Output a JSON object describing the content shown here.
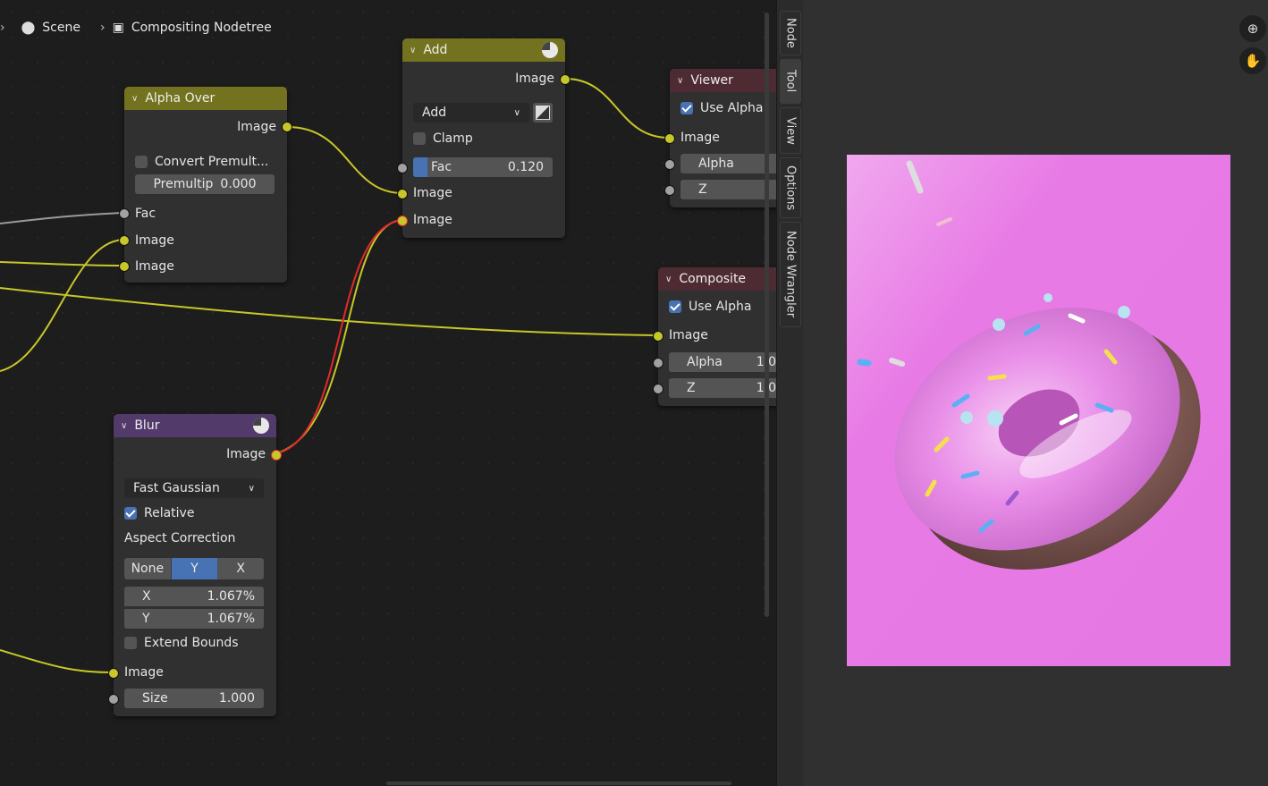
{
  "breadcrumb": {
    "scene": "Scene",
    "tree": "Compositing Nodetree"
  },
  "alpha_over": {
    "title": "Alpha Over",
    "out_image": "Image",
    "convert": "Convert Premult...",
    "premult_label": "Premultip",
    "premult_value": "0.000",
    "fac": "Fac",
    "image1": "Image",
    "image2": "Image"
  },
  "add": {
    "title": "Add",
    "out_image": "Image",
    "mode": "Add",
    "clamp": "Clamp",
    "fac_label": "Fac",
    "fac_value": "0.120",
    "image1": "Image",
    "image2": "Image"
  },
  "viewer": {
    "title": "Viewer",
    "use_alpha": "Use Alpha",
    "image": "Image",
    "alpha": "Alpha",
    "z": "Z"
  },
  "composite": {
    "title": "Composite",
    "use_alpha": "Use Alpha",
    "image": "Image",
    "alpha": "Alpha",
    "alpha_value": "1.0",
    "z": "Z",
    "z_value": "1.0"
  },
  "blur": {
    "title": "Blur",
    "out_image": "Image",
    "filter": "Fast Gaussian",
    "relative": "Relative",
    "aspect": "Aspect Correction",
    "opt_none": "None",
    "opt_y": "Y",
    "opt_x": "X",
    "x_label": "X",
    "x_value": "1.067%",
    "y_label": "Y",
    "y_value": "1.067%",
    "extend": "Extend Bounds",
    "in_image": "Image",
    "size_label": "Size",
    "size_value": "1.000"
  },
  "sidebar_tabs": [
    "Node",
    "Tool",
    "View",
    "Options",
    "Node Wrangler"
  ],
  "colors": {
    "converter_header": "#73731f",
    "filter_header": "#523a6b",
    "output_header": "#4e2b33",
    "socket_color": "#c7c729",
    "wire_yellow": "#c7c729",
    "wire_red": "#e02a2a",
    "accent": "#4772b3",
    "donut_bg": "#e87ae6"
  }
}
